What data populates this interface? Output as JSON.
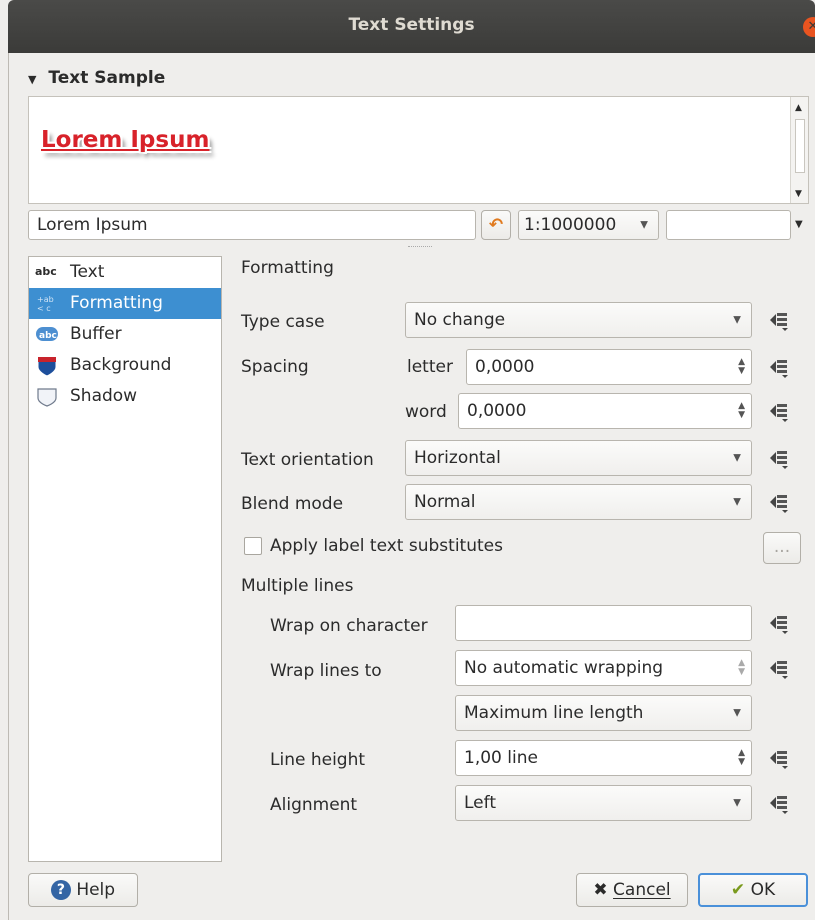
{
  "window": {
    "title": "Text Settings",
    "close_glyph": "✕"
  },
  "sample": {
    "section_title": "Text Sample",
    "preview_text": "Lorem Ipsum",
    "input_value": "Lorem Ipsum",
    "scale_value": "1:1000000",
    "reset_glyph": "↶"
  },
  "sidebar": {
    "items": [
      {
        "label": "Text",
        "icon": "abc-text-icon",
        "selected": false
      },
      {
        "label": "Formatting",
        "icon": "formatting-icon",
        "selected": true
      },
      {
        "label": "Buffer",
        "icon": "buffer-icon",
        "selected": false
      },
      {
        "label": "Background",
        "icon": "background-shield-icon",
        "selected": false
      },
      {
        "label": "Shadow",
        "icon": "shadow-icon",
        "selected": false
      }
    ]
  },
  "formatting": {
    "heading": "Formatting",
    "type_case": {
      "label": "Type case",
      "value": "No change"
    },
    "spacing": {
      "label": "Spacing",
      "letter_label": "letter",
      "letter_value": "0,0000",
      "word_label": "word",
      "word_value": "0,0000"
    },
    "text_orientation": {
      "label": "Text orientation",
      "value": "Horizontal"
    },
    "blend_mode": {
      "label": "Blend mode",
      "value": "Normal"
    },
    "substitutes": {
      "label": "Apply label text substitutes",
      "checked": false,
      "button": "..."
    },
    "multiple_lines": {
      "heading": "Multiple lines",
      "wrap_char": {
        "label": "Wrap on character",
        "value": ""
      },
      "wrap_lines": {
        "label": "Wrap lines to",
        "value": "No automatic wrapping",
        "mode": "Maximum line length"
      },
      "line_height": {
        "label": "Line height",
        "value": "1,00 line"
      },
      "alignment": {
        "label": "Alignment",
        "value": "Left"
      }
    }
  },
  "footer": {
    "help_label": "Help",
    "cancel_label": "Cancel",
    "ok_label": "OK"
  },
  "colors": {
    "accent": "#3d8fd1",
    "titlebar": "#3b3b39",
    "close": "#e95420",
    "sample_text": "#d8222a"
  }
}
